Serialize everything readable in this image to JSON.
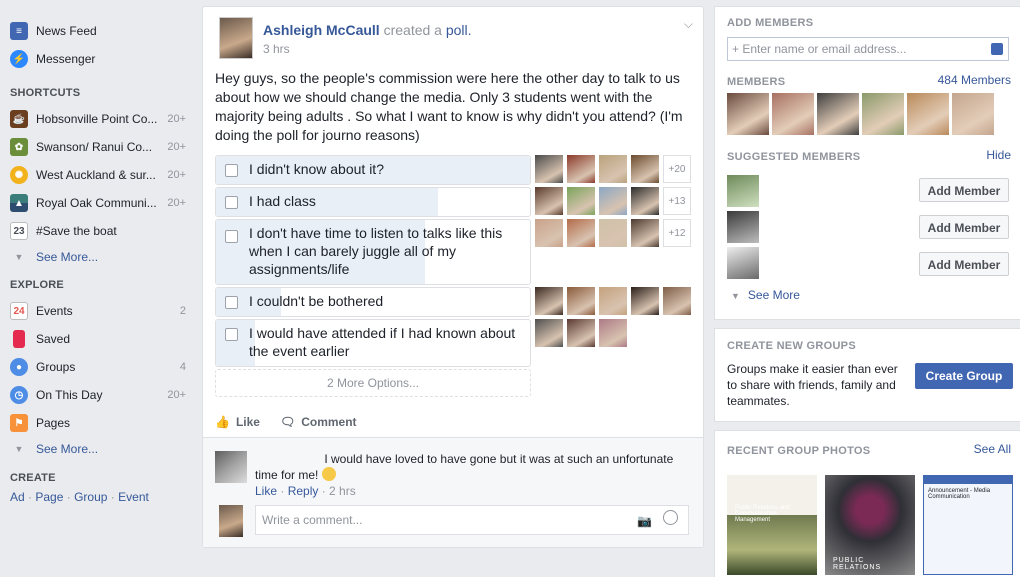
{
  "left_nav": {
    "items": [
      {
        "label": "News Feed",
        "count": "",
        "icon": "news-feed-icon",
        "color": "#4267b2"
      },
      {
        "label": "Messenger",
        "count": "",
        "icon": "messenger-icon",
        "color": "#2d88ff"
      }
    ],
    "shortcuts_title": "SHORTCUTS",
    "shortcuts": [
      {
        "label": "Hobsonville Point Co...",
        "count": "20+",
        "icon": "coffee-icon",
        "color": "#6b3e1f"
      },
      {
        "label": "Swanson/ Ranui Co...",
        "count": "20+",
        "icon": "plant-icon",
        "color": "#6a8e3a"
      },
      {
        "label": "West Auckland & sur...",
        "count": "20+",
        "icon": "sunflower-icon",
        "color": "#f2b21b"
      },
      {
        "label": "Royal Oak Communi...",
        "count": "20+",
        "icon": "landscape-icon",
        "color": "#3a7d7a"
      },
      {
        "label": "#Save the boat",
        "count": "",
        "icon": "calendar-icon",
        "color": "#ffffff",
        "day": "23"
      }
    ],
    "shortcuts_see_more": "See More...",
    "explore_title": "EXPLORE",
    "explore": [
      {
        "label": "Events",
        "count": "2",
        "icon": "events-calendar-icon",
        "color": "#ffffff",
        "day": "24"
      },
      {
        "label": "Saved",
        "count": "",
        "icon": "bookmark-icon",
        "color": "#e42a4f"
      },
      {
        "label": "Groups",
        "count": "4",
        "icon": "groups-icon",
        "color": "#4e8de6"
      },
      {
        "label": "On This Day",
        "count": "20+",
        "icon": "clock-icon",
        "color": "#4e8de6"
      },
      {
        "label": "Pages",
        "count": "",
        "icon": "flag-icon",
        "color": "#f7923b"
      }
    ],
    "explore_see_more": "See More...",
    "create_title": "CREATE",
    "create_links": [
      "Ad",
      "Page",
      "Group",
      "Event"
    ]
  },
  "post": {
    "author": "Ashleigh McCaull",
    "action": "created a",
    "object": "poll.",
    "time": "3 hrs",
    "text": "Hey guys, so the people's commission were here the other day to talk to us about how we should change the media. Only 3 students went with the majority being adults . So what I want to know is why didn't you attend? (I'm doing the poll for journo reasons)",
    "options": [
      {
        "text": "I didn't know about it?",
        "votes": 24,
        "extra": "+20",
        "faces": [
          "#4a4a4a",
          "#8b3a2a",
          "#b9a27c",
          "#6a4b2e"
        ]
      },
      {
        "text": "I had class",
        "votes": 17,
        "extra": "+13",
        "faces": [
          "#5a3b2b",
          "#7aa35a",
          "#8ba7c4",
          "#2b2b2b"
        ]
      },
      {
        "text": "I don't have time to listen to talks like this when I can barely juggle all of my assignments/life",
        "votes": 16,
        "extra": "+12",
        "faces": [
          "#c9a18a",
          "#b36b4a",
          "#cfc1a8",
          "#4c3a30"
        ]
      },
      {
        "text": "I couldn't be bothered",
        "votes": 5,
        "extra": "",
        "faces": [
          "#3b2a22",
          "#8a5a3a",
          "#c4a27e",
          "#2a1f1a",
          "#7e5d48"
        ]
      },
      {
        "text": "I would have attended if I had known about the event earlier",
        "votes": 3,
        "extra": "",
        "faces": [
          "#4f4f4f",
          "#5b3a34",
          "#ad7a86"
        ]
      }
    ],
    "more_options": "2 More Options...",
    "like_label": "Like",
    "comment_label": "Comment",
    "comment": {
      "text": "I would have loved to have gone but it was at such an unfortunate time for me!",
      "like": "Like",
      "reply": "Reply",
      "time": "2 hrs"
    },
    "write_placeholder": "Write a comment..."
  },
  "right": {
    "add_members_title": "ADD MEMBERS",
    "add_members_placeholder": "+ Enter name or email address...",
    "members_title": "MEMBERS",
    "members_count": "484 Members",
    "member_faces": [
      "#6a4a3e",
      "#a77062",
      "#3f3f3f",
      "#8a9a6a",
      "#b98a5a",
      "#c4a58e"
    ],
    "suggested_title": "SUGGESTED MEMBERS",
    "hide_label": "Hide",
    "suggested": [
      {
        "button": "Add Member",
        "face": "#6f8a5a"
      },
      {
        "button": "Add Member",
        "face": "#555555"
      },
      {
        "button": "Add Member",
        "face": "#7a7a7a"
      }
    ],
    "see_more": "See More",
    "create_groups_title": "CREATE NEW GROUPS",
    "create_groups_desc": "Groups make it easier than ever to share with friends, family and teammates.",
    "create_group_button": "Create Group",
    "recent_photos_title": "RECENT GROUP PHOTOS",
    "see_all": "See All",
    "photos": [
      {
        "caption": "Public Relations and Communication Management",
        "color": "#6f7a4f"
      },
      {
        "caption": "PUBLIC RELATIONS",
        "color": "#2f2f36"
      },
      {
        "caption": "Announcement - Media Communication",
        "color": "#f2f5fb"
      }
    ],
    "colors": {
      "accent": "#4267b2",
      "link": "#365899"
    }
  }
}
